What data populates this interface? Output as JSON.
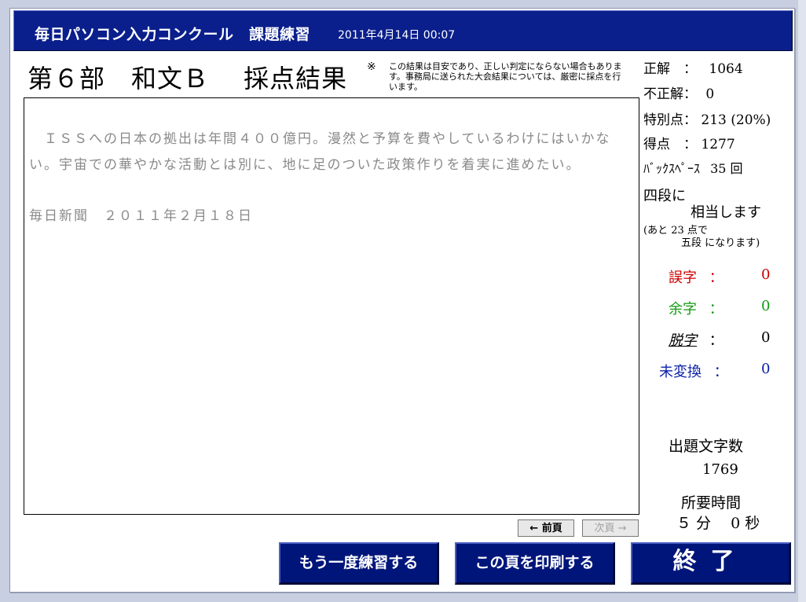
{
  "titlebar": {
    "app_title": "毎日パソコン入力コンクール　課題練習",
    "datetime": "2011年4月14日 00:07"
  },
  "header": {
    "section_title": "第６部　和文Ｂ　 採点結果",
    "note_mark": "※",
    "note": "この結果は目安であり、正しい判定にならない場合もあります。事務局に送られた大会結果については、厳密に採点を行います。"
  },
  "passage": {
    "text": "　ＩＳＳへの日本の拠出は年間４００億円。漫然と予算を費やしているわけにはいかない。宇宙での華やかな活動とは別に、地に足のついた政策作りを着実に進めたい。",
    "source": "毎日新聞　２０１１年２月１８日"
  },
  "stats": {
    "correct_label": "正解　：",
    "correct_value": "1064",
    "incorrect_label": "不正解：",
    "incorrect_value": "0",
    "bonus_label": "特別点：",
    "bonus_value": "213 (20%)",
    "score_label": "得点　：",
    "score_value": "1277",
    "backspace_label": "ﾊﾞｯｸｽﾍﾟｰｽ",
    "backspace_value": "35 回",
    "rank_line1": "四段に",
    "rank_line2": "相当します",
    "next_rank_line1": "(あと 23 点で",
    "next_rank_line2": "五段 になります)"
  },
  "errors": {
    "typo_label": "誤字",
    "typo_value": "0",
    "typo_color": "#cc0000",
    "extra_label": "余字",
    "extra_value": "0",
    "extra_color": "#119911",
    "missing_label": "脱字",
    "missing_value": "0",
    "unconverted_label": "未変換",
    "unconverted_value": "0",
    "unconverted_color": "#0a1fa8",
    "separator": "："
  },
  "summary": {
    "chars_label": "出題文字数",
    "chars_value": "1769",
    "time_label": "所要時間",
    "time_value": "５ 分　 0 秒"
  },
  "nav": {
    "prev_label": "← 前頁",
    "next_label": "次頁 →"
  },
  "actions": {
    "retry_label": "もう一度練習する",
    "print_label": "この頁を印刷する",
    "end_label": "終了"
  }
}
